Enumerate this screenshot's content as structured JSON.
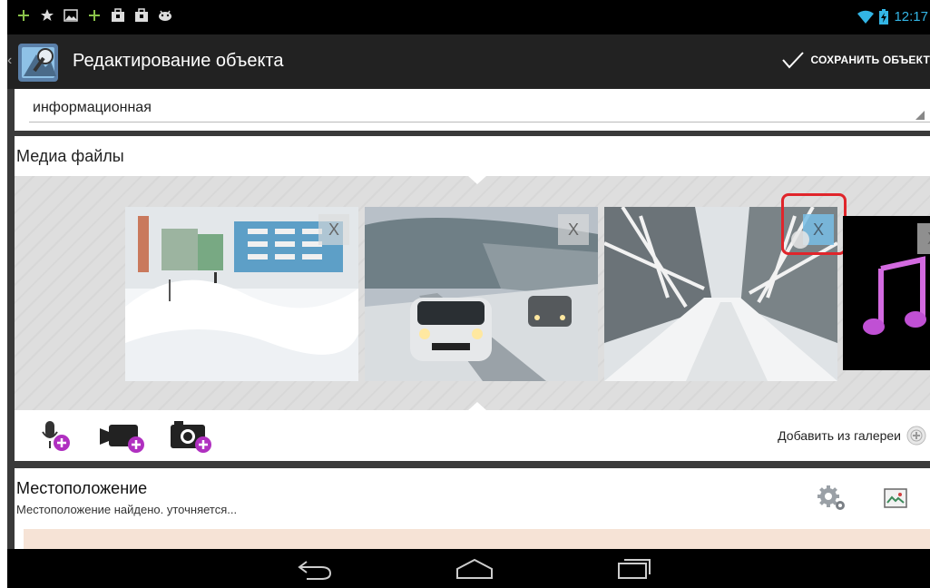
{
  "status_bar": {
    "time": "12:17",
    "icons": [
      "plus-icon",
      "star-icon",
      "image-icon",
      "plus-icon",
      "briefcase-icon",
      "briefcase-icon",
      "android-icon",
      "wifi-icon",
      "battery-icon"
    ]
  },
  "action_bar": {
    "title": "Редактирование объекта",
    "save_label": "СОХРАНИТЬ ОБЪЕКТ"
  },
  "category_spinner": {
    "value": "информационная"
  },
  "media": {
    "title": "Медиа файлы",
    "thumbnails": [
      {
        "type": "photo",
        "remove_label": "X"
      },
      {
        "type": "photo",
        "remove_label": "X"
      },
      {
        "type": "photo",
        "remove_label": "X"
      },
      {
        "type": "audio",
        "remove_label": "X"
      }
    ],
    "add_from_gallery_label": "Добавить из галереи",
    "action_icons": [
      "add-audio-icon",
      "add-video-icon",
      "add-photo-icon"
    ]
  },
  "location": {
    "title": "Местоположение",
    "status": "Местоположение найдено. уточняется..."
  },
  "colors": {
    "accent": "#33b5e5",
    "highlight": "#e0252b",
    "action_plus": "#b030c0"
  }
}
